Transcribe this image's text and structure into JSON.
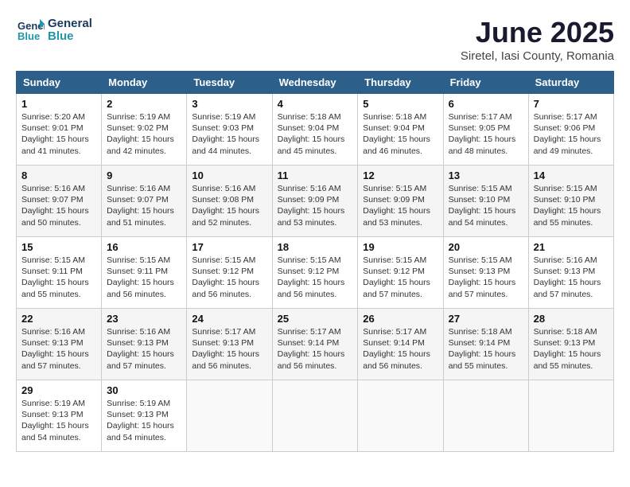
{
  "header": {
    "logo_line1": "General",
    "logo_line2": "Blue",
    "month_year": "June 2025",
    "location": "Siretel, Iasi County, Romania"
  },
  "columns": [
    "Sunday",
    "Monday",
    "Tuesday",
    "Wednesday",
    "Thursday",
    "Friday",
    "Saturday"
  ],
  "rows": [
    [
      {
        "day": "1",
        "sunrise": "Sunrise: 5:20 AM",
        "sunset": "Sunset: 9:01 PM",
        "daylight": "Daylight: 15 hours and 41 minutes."
      },
      {
        "day": "2",
        "sunrise": "Sunrise: 5:19 AM",
        "sunset": "Sunset: 9:02 PM",
        "daylight": "Daylight: 15 hours and 42 minutes."
      },
      {
        "day": "3",
        "sunrise": "Sunrise: 5:19 AM",
        "sunset": "Sunset: 9:03 PM",
        "daylight": "Daylight: 15 hours and 44 minutes."
      },
      {
        "day": "4",
        "sunrise": "Sunrise: 5:18 AM",
        "sunset": "Sunset: 9:04 PM",
        "daylight": "Daylight: 15 hours and 45 minutes."
      },
      {
        "day": "5",
        "sunrise": "Sunrise: 5:18 AM",
        "sunset": "Sunset: 9:04 PM",
        "daylight": "Daylight: 15 hours and 46 minutes."
      },
      {
        "day": "6",
        "sunrise": "Sunrise: 5:17 AM",
        "sunset": "Sunset: 9:05 PM",
        "daylight": "Daylight: 15 hours and 48 minutes."
      },
      {
        "day": "7",
        "sunrise": "Sunrise: 5:17 AM",
        "sunset": "Sunset: 9:06 PM",
        "daylight": "Daylight: 15 hours and 49 minutes."
      }
    ],
    [
      {
        "day": "8",
        "sunrise": "Sunrise: 5:16 AM",
        "sunset": "Sunset: 9:07 PM",
        "daylight": "Daylight: 15 hours and 50 minutes."
      },
      {
        "day": "9",
        "sunrise": "Sunrise: 5:16 AM",
        "sunset": "Sunset: 9:07 PM",
        "daylight": "Daylight: 15 hours and 51 minutes."
      },
      {
        "day": "10",
        "sunrise": "Sunrise: 5:16 AM",
        "sunset": "Sunset: 9:08 PM",
        "daylight": "Daylight: 15 hours and 52 minutes."
      },
      {
        "day": "11",
        "sunrise": "Sunrise: 5:16 AM",
        "sunset": "Sunset: 9:09 PM",
        "daylight": "Daylight: 15 hours and 53 minutes."
      },
      {
        "day": "12",
        "sunrise": "Sunrise: 5:15 AM",
        "sunset": "Sunset: 9:09 PM",
        "daylight": "Daylight: 15 hours and 53 minutes."
      },
      {
        "day": "13",
        "sunrise": "Sunrise: 5:15 AM",
        "sunset": "Sunset: 9:10 PM",
        "daylight": "Daylight: 15 hours and 54 minutes."
      },
      {
        "day": "14",
        "sunrise": "Sunrise: 5:15 AM",
        "sunset": "Sunset: 9:10 PM",
        "daylight": "Daylight: 15 hours and 55 minutes."
      }
    ],
    [
      {
        "day": "15",
        "sunrise": "Sunrise: 5:15 AM",
        "sunset": "Sunset: 9:11 PM",
        "daylight": "Daylight: 15 hours and 55 minutes."
      },
      {
        "day": "16",
        "sunrise": "Sunrise: 5:15 AM",
        "sunset": "Sunset: 9:11 PM",
        "daylight": "Daylight: 15 hours and 56 minutes."
      },
      {
        "day": "17",
        "sunrise": "Sunrise: 5:15 AM",
        "sunset": "Sunset: 9:12 PM",
        "daylight": "Daylight: 15 hours and 56 minutes."
      },
      {
        "day": "18",
        "sunrise": "Sunrise: 5:15 AM",
        "sunset": "Sunset: 9:12 PM",
        "daylight": "Daylight: 15 hours and 56 minutes."
      },
      {
        "day": "19",
        "sunrise": "Sunrise: 5:15 AM",
        "sunset": "Sunset: 9:12 PM",
        "daylight": "Daylight: 15 hours and 57 minutes."
      },
      {
        "day": "20",
        "sunrise": "Sunrise: 5:15 AM",
        "sunset": "Sunset: 9:13 PM",
        "daylight": "Daylight: 15 hours and 57 minutes."
      },
      {
        "day": "21",
        "sunrise": "Sunrise: 5:16 AM",
        "sunset": "Sunset: 9:13 PM",
        "daylight": "Daylight: 15 hours and 57 minutes."
      }
    ],
    [
      {
        "day": "22",
        "sunrise": "Sunrise: 5:16 AM",
        "sunset": "Sunset: 9:13 PM",
        "daylight": "Daylight: 15 hours and 57 minutes."
      },
      {
        "day": "23",
        "sunrise": "Sunrise: 5:16 AM",
        "sunset": "Sunset: 9:13 PM",
        "daylight": "Daylight: 15 hours and 57 minutes."
      },
      {
        "day": "24",
        "sunrise": "Sunrise: 5:17 AM",
        "sunset": "Sunset: 9:13 PM",
        "daylight": "Daylight: 15 hours and 56 minutes."
      },
      {
        "day": "25",
        "sunrise": "Sunrise: 5:17 AM",
        "sunset": "Sunset: 9:14 PM",
        "daylight": "Daylight: 15 hours and 56 minutes."
      },
      {
        "day": "26",
        "sunrise": "Sunrise: 5:17 AM",
        "sunset": "Sunset: 9:14 PM",
        "daylight": "Daylight: 15 hours and 56 minutes."
      },
      {
        "day": "27",
        "sunrise": "Sunrise: 5:18 AM",
        "sunset": "Sunset: 9:14 PM",
        "daylight": "Daylight: 15 hours and 55 minutes."
      },
      {
        "day": "28",
        "sunrise": "Sunrise: 5:18 AM",
        "sunset": "Sunset: 9:13 PM",
        "daylight": "Daylight: 15 hours and 55 minutes."
      }
    ],
    [
      {
        "day": "29",
        "sunrise": "Sunrise: 5:19 AM",
        "sunset": "Sunset: 9:13 PM",
        "daylight": "Daylight: 15 hours and 54 minutes."
      },
      {
        "day": "30",
        "sunrise": "Sunrise: 5:19 AM",
        "sunset": "Sunset: 9:13 PM",
        "daylight": "Daylight: 15 hours and 54 minutes."
      },
      null,
      null,
      null,
      null,
      null
    ]
  ]
}
